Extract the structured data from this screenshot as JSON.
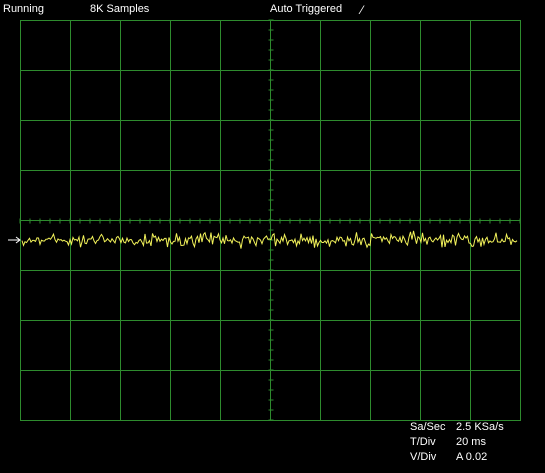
{
  "status": {
    "run_state": "Running",
    "samples": "8K Samples",
    "trigger_mode": "Auto Triggered",
    "trigger_slope_glyph": "⁄",
    "trigger_slope_icon": "rising-edge-icon"
  },
  "display": {
    "divisions_x": 10,
    "divisions_y": 8,
    "grid_color": "#2e8b2e",
    "trace_color": "#f2f25a",
    "background": "#000000",
    "ground_marker_icon": "channel-ground-arrow-icon"
  },
  "readouts": {
    "sample_rate_label": "Sa/Sec",
    "sample_rate_value": "2.5 KSa/s",
    "time_div_label": "T/Div",
    "time_div_value": "20 ms",
    "volt_div_label": "V/Div",
    "volt_div_value": "A 0.02"
  },
  "chart_data": {
    "type": "line",
    "series": [
      {
        "channel": "A",
        "center_div": -0.4,
        "noise_amplitude_div": 0.12
      }
    ]
  }
}
